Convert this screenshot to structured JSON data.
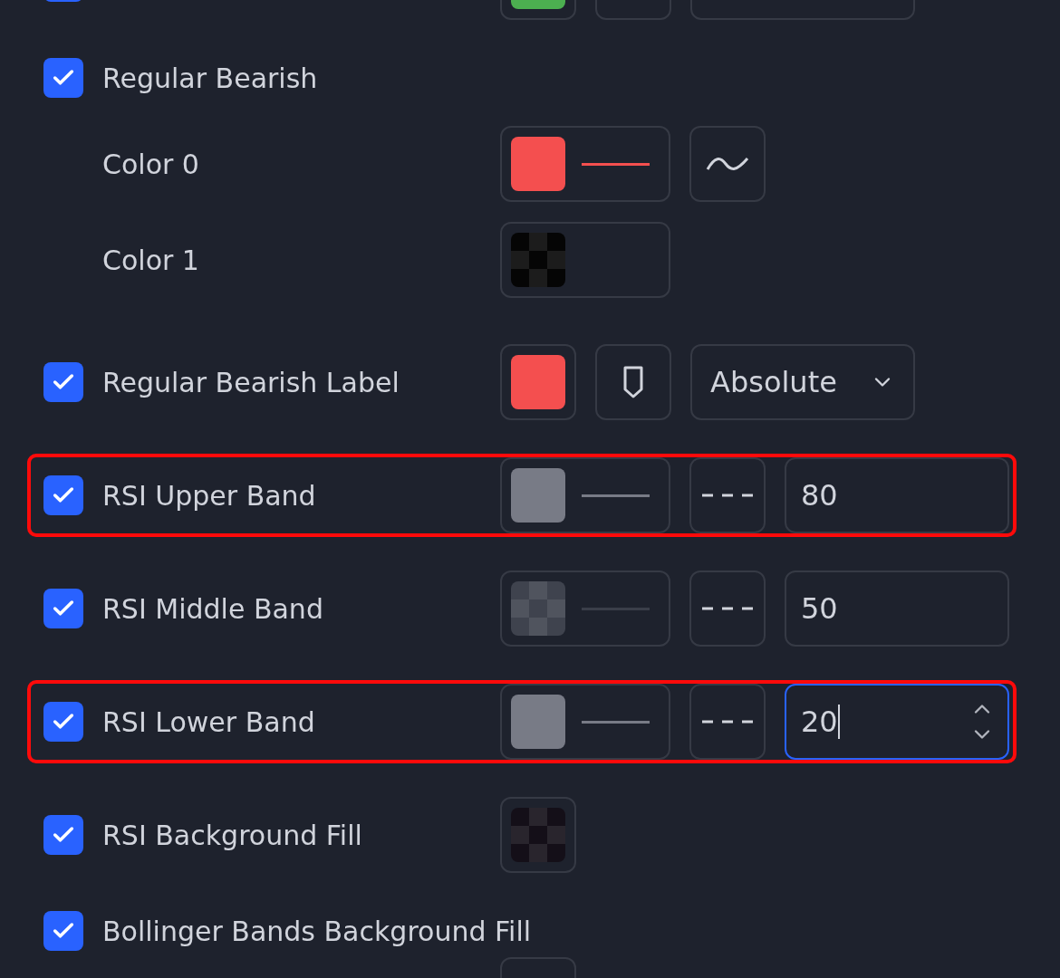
{
  "rows": [
    {
      "kind": "label",
      "checked": true,
      "swatch": {
        "color": "#4caf50",
        "transparent": false
      }
    },
    {
      "kind": "group",
      "checked": true,
      "label": "Regular Bearish"
    },
    {
      "kind": "color_line",
      "label": "Color 0",
      "swatch": {
        "color": "#f44f4f",
        "transparent": false
      }
    },
    {
      "kind": "color",
      "label": "Color 1",
      "swatch": {
        "color": "#050505",
        "transparent": true
      }
    },
    {
      "kind": "label",
      "checked": true,
      "label": "Regular Bearish Label",
      "swatch": {
        "color": "#f44f4f",
        "transparent": false
      },
      "position": "Absolute"
    },
    {
      "kind": "band",
      "checked": true,
      "label": "RSI Upper Band",
      "swatch": {
        "color": "#787b86",
        "transparent": false
      },
      "value": "80",
      "focused": false,
      "highlighted": true
    },
    {
      "kind": "band",
      "checked": true,
      "label": "RSI Middle Band",
      "swatch": {
        "color": "#3f434e",
        "transparent": true
      },
      "value": "50",
      "focused": false,
      "highlighted": false
    },
    {
      "kind": "band",
      "checked": true,
      "label": "RSI Lower Band",
      "swatch": {
        "color": "#787b86",
        "transparent": false
      },
      "value": "20",
      "focused": true,
      "highlighted": true
    },
    {
      "kind": "fill",
      "checked": true,
      "label": "RSI Background Fill",
      "swatch": {
        "color": "#140f18",
        "transparent": true
      }
    },
    {
      "kind": "group",
      "checked": true,
      "label": "Bollinger Bands Background Fill"
    },
    {
      "kind": "partial"
    }
  ]
}
